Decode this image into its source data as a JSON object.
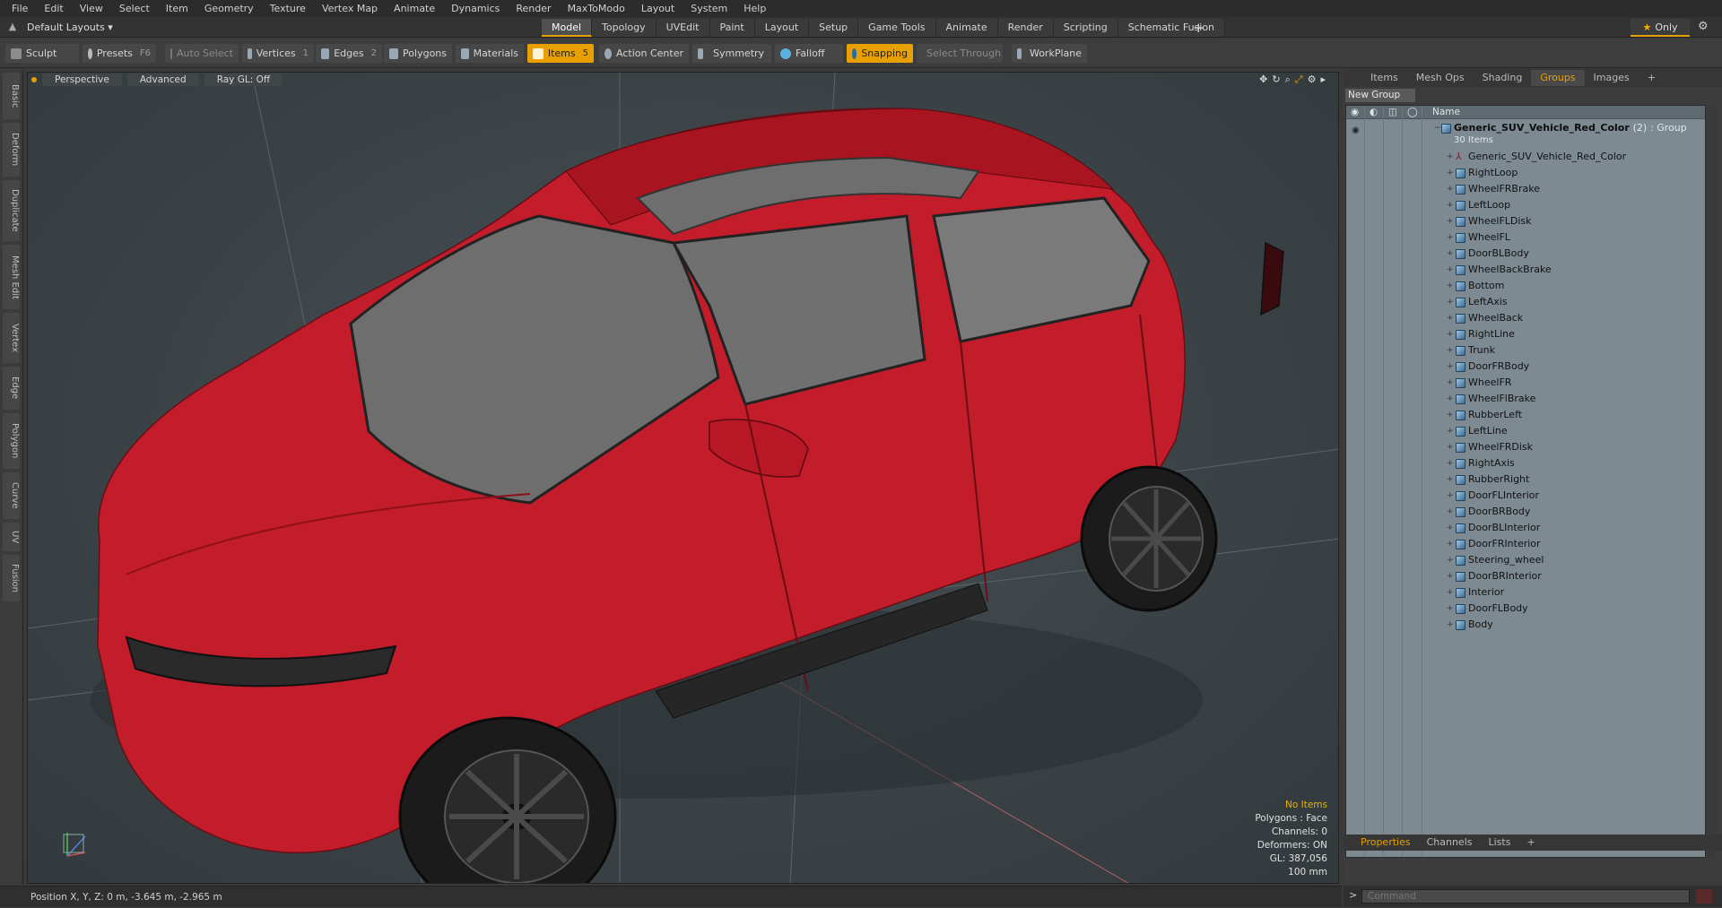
{
  "menu": [
    "File",
    "Edit",
    "View",
    "Select",
    "Item",
    "Geometry",
    "Texture",
    "Vertex Map",
    "Animate",
    "Dynamics",
    "Render",
    "MaxToModo",
    "Layout",
    "System",
    "Help"
  ],
  "layout_selector": "Default Layouts ▾",
  "mode_tabs": [
    {
      "label": "Model",
      "active": true
    },
    {
      "label": "Topology"
    },
    {
      "label": "UVEdit"
    },
    {
      "label": "Paint"
    },
    {
      "label": "Layout"
    },
    {
      "label": "Setup"
    },
    {
      "label": "Game Tools"
    },
    {
      "label": "Animate"
    },
    {
      "label": "Render"
    },
    {
      "label": "Scripting"
    },
    {
      "label": "Schematic Fusion"
    }
  ],
  "tab_plus": "+",
  "only_label": "Only",
  "toolbar": {
    "sculpt": "Sculpt",
    "presets": "Presets",
    "presets_key": "F6",
    "auto_select": "Auto Select",
    "vertices": "Vertices",
    "vertices_key": "1",
    "edges": "Edges",
    "edges_key": "2",
    "polygons": "Polygons",
    "materials": "Materials",
    "items": "Items",
    "items_key": "5",
    "action_center": "Action Center",
    "symmetry": "Symmetry",
    "falloff": "Falloff",
    "snapping": "Snapping",
    "select_through": "Select Through",
    "workplane": "WorkPlane"
  },
  "left_tabs": [
    "Basic",
    "Deform",
    "Duplicate",
    "Mesh Edit",
    "Vertex",
    "Edge",
    "Polygon",
    "Curve",
    "UV",
    "Fusion"
  ],
  "viewport": {
    "view": "Perspective",
    "style": "Advanced",
    "raygl": "Ray GL: Off",
    "stats": {
      "no_items": "No Items",
      "polygons": "Polygons : Face",
      "channels": "Channels: 0",
      "deformers": "Deformers: ON",
      "gl": "GL: 387,056",
      "scale": "100 mm"
    },
    "colors": {
      "body": "#c31c2a",
      "glass": "#6e6e6e",
      "tire": "#1b1b1b"
    }
  },
  "right_tabs": [
    {
      "label": "Items"
    },
    {
      "label": "Mesh Ops"
    },
    {
      "label": "Shading"
    },
    {
      "label": "Groups",
      "active": true
    },
    {
      "label": "Images"
    },
    {
      "label": "+"
    }
  ],
  "new_group": "New Group",
  "tree_header": "Name",
  "group": {
    "name": "Generic_SUV_Vehicle_Red_Color",
    "count": "(2)",
    "type": ": Group",
    "items": "30 Items"
  },
  "items": [
    "Generic_SUV_Vehicle_Red_Color",
    "RightLoop",
    "WheelFRBrake",
    "LeftLoop",
    "WheelFLDisk",
    "WheelFL",
    "DoorBLBody",
    "WheelBackBrake",
    "Bottom",
    "LeftAxis",
    "WheelBack",
    "RightLine",
    "Trunk",
    "DoorFRBody",
    "WheelFR",
    "WheelFlBrake",
    "RubberLeft",
    "LeftLine",
    "WheelFRDisk",
    "RightAxis",
    "RubberRight",
    "DoorFLInterior",
    "DoorBRBody",
    "DoorBLInterior",
    "DoorFRInterior",
    "Steering_wheel",
    "DoorBRInterior",
    "Interior",
    "DoorFLBody",
    "Body"
  ],
  "bottom_tabs": [
    {
      "label": "Properties",
      "active": true
    },
    {
      "label": "Channels"
    },
    {
      "label": "Lists"
    },
    {
      "label": "+"
    }
  ],
  "status": "Position X, Y, Z:  0 m, -3.645 m, -2.965 m",
  "command_placeholder": "Command",
  "accent": "#e8a000"
}
